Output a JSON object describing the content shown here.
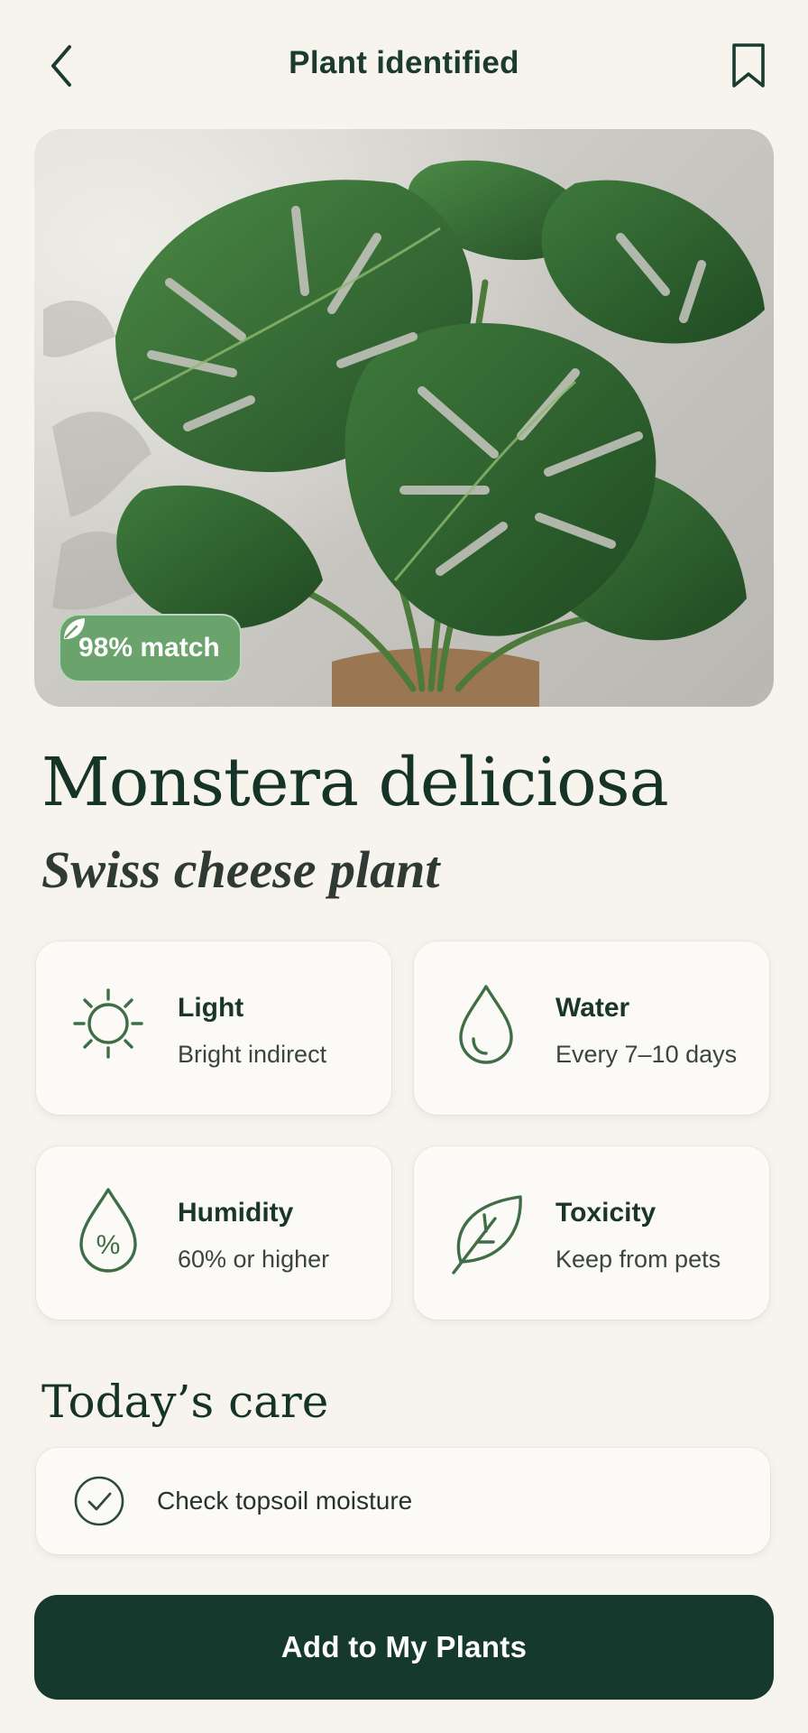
{
  "header": {
    "title": "Plant identified",
    "back_icon": "chevron-left-icon",
    "bookmark_icon": "bookmark-icon"
  },
  "hero": {
    "image_subject": "monstera-plant-photo",
    "match_badge": {
      "icon": "leaf-icon",
      "label": "98% match"
    }
  },
  "plant": {
    "scientific_name": "Monstera deliciosa",
    "common_name": "Swiss cheese plant"
  },
  "care": [
    {
      "icon": "sun-icon",
      "label": "Light",
      "value": "Bright indirect"
    },
    {
      "icon": "water-drop-icon",
      "label": "Water",
      "value": "Every 7–10 days"
    },
    {
      "icon": "humidity-icon",
      "label": "Humidity",
      "value": "60% or higher"
    },
    {
      "icon": "leaf-outline-icon",
      "label": "Toxicity",
      "value": "Keep from pets"
    }
  ],
  "today": {
    "title": "Today’s care",
    "tasks": [
      {
        "icon": "check-circle-icon",
        "label": "Check topsoil moisture"
      }
    ]
  },
  "cta": {
    "label": "Add to My Plants"
  },
  "colors": {
    "background": "#f7f4ed",
    "primary": "#16392d",
    "accent_green": "#6aa36b",
    "icon_green": "#3f6e46"
  }
}
